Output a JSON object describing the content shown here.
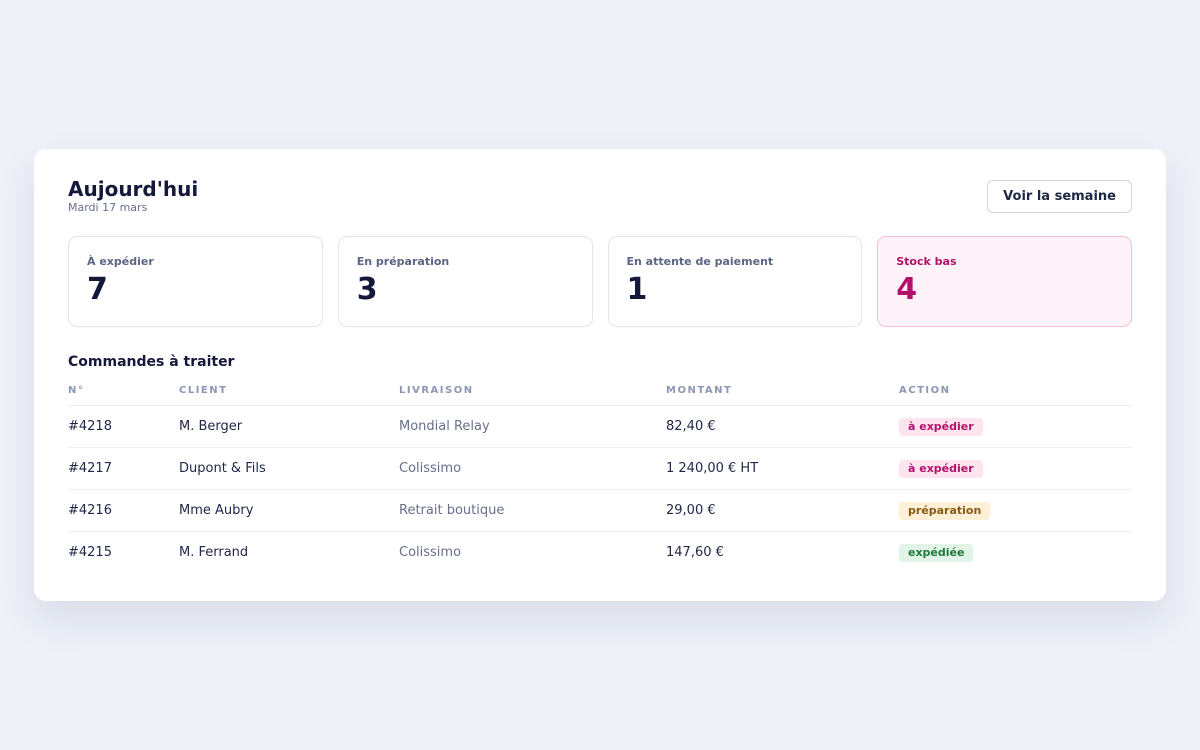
{
  "header": {
    "title": "Aujourd'hui",
    "date": "Mardi 17 mars",
    "week_button": "Voir la semaine"
  },
  "kpis": [
    {
      "label": "À expédier",
      "value": "7"
    },
    {
      "label": "En préparation",
      "value": "3"
    },
    {
      "label": "En attente de paiement",
      "value": "1"
    },
    {
      "label": "Stock bas",
      "value": "4"
    }
  ],
  "orders": {
    "title": "Commandes à traiter",
    "columns": [
      "N°",
      "CLIENT",
      "LIVRAISON",
      "MONTANT",
      "ACTION"
    ],
    "rows": [
      {
        "id": "#4218",
        "client": "M. Berger",
        "delivery": "Mondial Relay",
        "amount": "82,40 €",
        "action": "à expédier"
      },
      {
        "id": "#4217",
        "client": "Dupont & Fils",
        "delivery": "Colissimo",
        "amount": "1 240,00 € HT",
        "action": "à expédier"
      },
      {
        "id": "#4216",
        "client": "Mme Aubry",
        "delivery": "Retrait boutique",
        "amount": "29,00 €",
        "action": "préparation"
      },
      {
        "id": "#4215",
        "client": "M. Ferrand",
        "delivery": "Colissimo",
        "amount": "147,60 €",
        "action": "expédiée"
      }
    ]
  },
  "colors": {
    "alert": "#b3126b",
    "badge_ship": "#fde4ef",
    "badge_prep": "#fdf0d6",
    "badge_done": "#e2f4e7"
  }
}
